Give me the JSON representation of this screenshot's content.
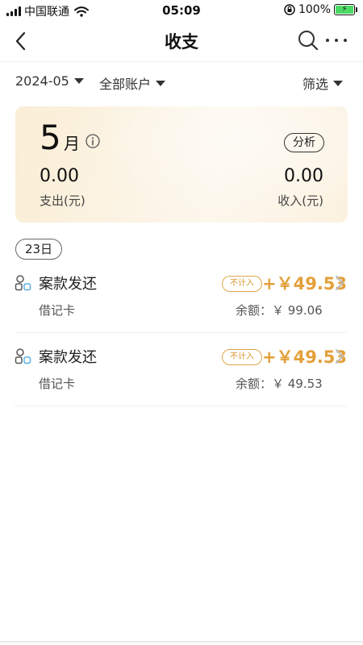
{
  "status_bar": {
    "carrier": "中国联通",
    "time": "05:09",
    "battery": "100%",
    "icons": [
      "signal-icon",
      "wifi-icon",
      "lock-rotation-icon",
      "battery-charging-icon"
    ]
  },
  "header": {
    "title": "收支",
    "icons": [
      "back-icon",
      "search-icon",
      "more-icon"
    ]
  },
  "filters": {
    "month": "2024-05",
    "account": "全部账户",
    "filter": "筛选"
  },
  "summary": {
    "month_number": "5",
    "month_unit": "月",
    "analyze_label": "分析",
    "expense_value": "0.00",
    "expense_label": "支出(元)",
    "income_value": "0.00",
    "income_label": "收入(元)"
  },
  "date_group": "23日",
  "transactions": [
    {
      "title": "案款发还",
      "account": "借记卡",
      "badge": "不计入",
      "amount": "+￥49.53",
      "balance": "余额：￥ 99.06"
    },
    {
      "title": "案款发还",
      "account": "借记卡",
      "badge": "不计入",
      "amount": "+￥49.53",
      "balance": "余额：￥ 49.53"
    }
  ],
  "colors": {
    "accent": "#e3a03a",
    "card_bg": "#fbf1df",
    "text": "#222222"
  }
}
